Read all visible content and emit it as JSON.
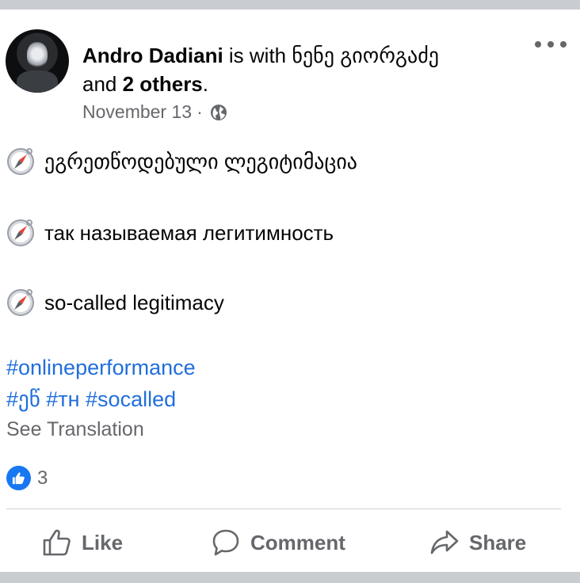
{
  "post": {
    "author": "Andro Dadiani",
    "with_text": "is with",
    "tagged_name": "ნენე გიორგაძე",
    "and_text": "and",
    "others": "2 others",
    "period": ".",
    "date": "November 13",
    "separator": "·",
    "audience_icon": "globe-icon",
    "lines": [
      {
        "icon": "compass-emoji",
        "text": "ეგრეთწოდებული ლეგიტიმაცია"
      },
      {
        "icon": "compass-emoji",
        "text": "так называемая легитимность"
      },
      {
        "icon": "compass-emoji",
        "text": "so-called legitimacy"
      }
    ],
    "hashtags": {
      "line1": "#onlineperformance",
      "tag_ge": "#ეწ",
      "tag_ru": "#тн",
      "tag_en": "#socalled"
    },
    "see_translation": "See Translation",
    "reaction_count": "3"
  },
  "actions": {
    "like": "Like",
    "comment": "Comment",
    "share": "Share"
  },
  "colors": {
    "link": "#216fdb",
    "secondary_text": "#65676b",
    "like_blue": "#1877f2",
    "band": "#c9ccd1"
  }
}
